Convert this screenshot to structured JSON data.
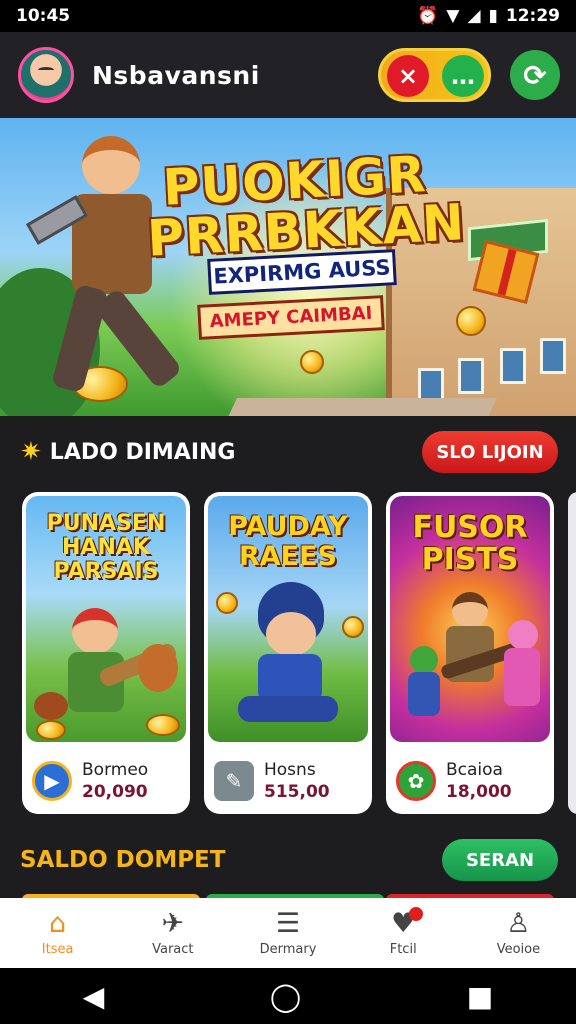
{
  "status_bar": {
    "time_left": "10:45",
    "time_right": "12:29",
    "icons": [
      "alarm-icon",
      "wifi-icon",
      "signal-icon",
      "battery-icon"
    ]
  },
  "header": {
    "app_name": "Nsbavansni",
    "close_icon": "×",
    "chat_icon": "…",
    "refresh_icon": "⟳"
  },
  "banner": {
    "title_line1": "PUOKIGR",
    "title_line2": "PRRBKKAN",
    "subtitle": "EXPIRMG AUSS",
    "tagline": "AMEPY CAIMBAI"
  },
  "section_games": {
    "title": "LADO DIMAING",
    "button_label": "SLO LIJOIN"
  },
  "cards": [
    {
      "art_title": "PUNASEN HANAK PARSAIS",
      "name": "Bormeo",
      "value": "20,090",
      "icon": "▶",
      "icon_color": "#2b6fd6"
    },
    {
      "art_title": "PAUDAY RAEES",
      "name": "Hosns",
      "value": "515,00",
      "icon": "✎",
      "icon_color": "#7b8a8f"
    },
    {
      "art_title": "FUSOR PISTS",
      "name": "Bcaioa",
      "value": "18,000",
      "icon": "✿",
      "icon_color": "#2ea33a"
    }
  ],
  "section_wallet": {
    "title": "SALDO DOMPET",
    "button_label": "SERAN"
  },
  "bottom_nav": [
    {
      "label": "Itsea",
      "icon": "⌂",
      "active": true,
      "badge": false
    },
    {
      "label": "Varact",
      "icon": "✈",
      "active": false,
      "badge": false
    },
    {
      "label": "Dermary",
      "icon": "☰",
      "active": false,
      "badge": false
    },
    {
      "label": "Ftcil",
      "icon": "♥",
      "active": false,
      "badge": true
    },
    {
      "label": "Veoioe",
      "icon": "♙",
      "active": false,
      "badge": false
    }
  ],
  "system_nav": {
    "back": "◀",
    "home": "◯",
    "recents": "■"
  },
  "colors": {
    "background": "#1d1d20",
    "accent_gold": "#f5b419",
    "accent_red": "#e11a2a",
    "accent_green": "#23b14d",
    "nav_active": "#f0901e"
  }
}
